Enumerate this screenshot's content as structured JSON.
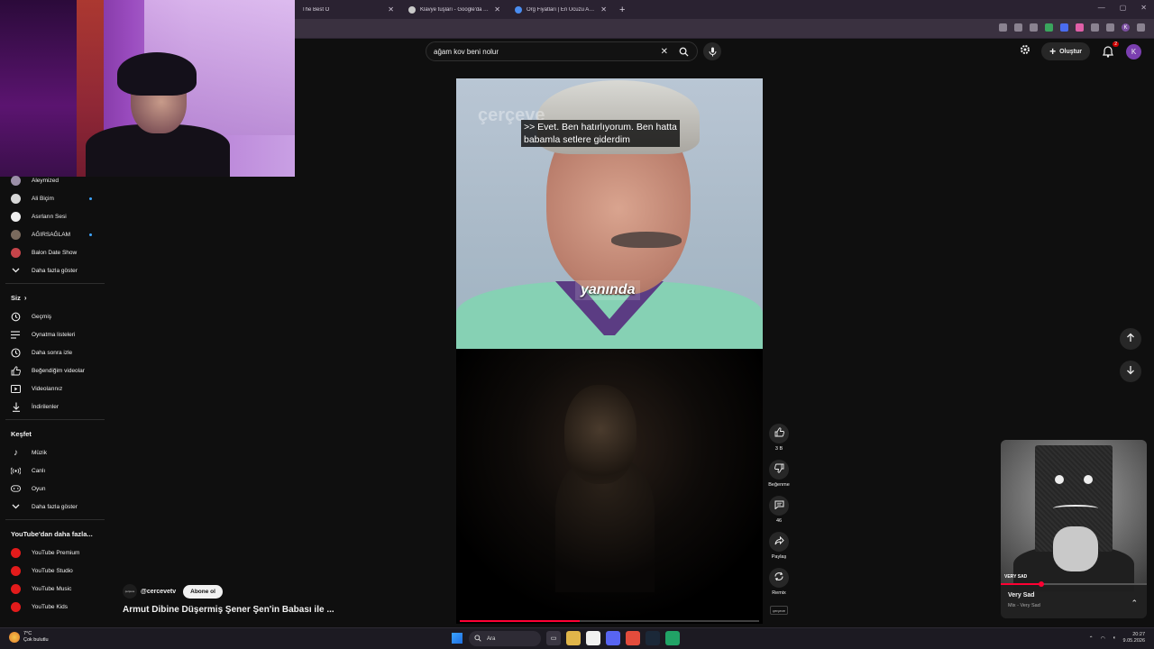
{
  "browser": {
    "tabs": [
      {
        "title": "The Best O"
      },
      {
        "title": "Klavye tuşları - Google'da Ara"
      },
      {
        "title": "Org Fiyatları | En Ucuzu Akakçe"
      }
    ],
    "new_tab_label": "+",
    "profile_initial": "K"
  },
  "search": {
    "query": "ağam kov beni nolur",
    "clear_label": "✕"
  },
  "header": {
    "create_label": "Oluştur",
    "notification_count": "2",
    "avatar_initial": "K"
  },
  "sidebar": {
    "subscriptions": [
      {
        "label": "Aleymized",
        "dot": false
      },
      {
        "label": "Ali Biçim",
        "dot": true
      },
      {
        "label": "Asırların Sesi",
        "dot": false
      },
      {
        "label": "AĞIRSAĞLAM",
        "dot": true
      },
      {
        "label": "Balon Date Show",
        "dot": false
      }
    ],
    "show_more_1": "Daha fazla göster",
    "you_heading": "Siz",
    "you_items": [
      {
        "label": "Geçmiş",
        "icon": "history-icon"
      },
      {
        "label": "Oynatma listeleri",
        "icon": "playlist-icon"
      },
      {
        "label": "Daha sonra izle",
        "icon": "clock-icon"
      },
      {
        "label": "Beğendiğim videolar",
        "icon": "thumbs-up-icon"
      },
      {
        "label": "Videolarınız",
        "icon": "video-icon"
      },
      {
        "label": "İndirilenler",
        "icon": "download-icon"
      }
    ],
    "explore_heading": "Keşfet",
    "explore_items": [
      {
        "label": "Müzik",
        "icon": "music-note-icon"
      },
      {
        "label": "Canlı",
        "icon": "live-icon"
      },
      {
        "label": "Oyun",
        "icon": "gamepad-icon"
      }
    ],
    "show_more_2": "Daha fazla göster",
    "more_heading": "YouTube'dan daha fazla...",
    "more_items": [
      {
        "label": "YouTube Premium"
      },
      {
        "label": "YouTube Studio"
      },
      {
        "label": "YouTube Music"
      },
      {
        "label": "YouTube Kids"
      }
    ]
  },
  "short": {
    "watermark": "çerçeve",
    "caption_line1": ">> Evet. Ben hatırlıyorum. Ben hatta",
    "caption_line2": "babamla setlere giderdim",
    "burned_subtitle": "yanında",
    "progress_fraction": 0.4,
    "channel_handle": "@cercevetv",
    "channel_avatar_text": "çerçeve",
    "subscribe_label": "Abone ol",
    "title": "Armut Dibine Düşermiş Şener Şen'in Babası ile ..."
  },
  "actions": {
    "like_count": "3 B",
    "dislike_label": "Beğenme",
    "comment_count": "46",
    "share_label": "Paylaş",
    "remix_label": "Remix",
    "audio_thumb_text": "çerçeve"
  },
  "miniplayer": {
    "cover_text": "VERY SAD",
    "title": "Very Sad",
    "subtitle": "Mix - Very Sad",
    "progress_fraction": 0.28
  },
  "taskbar": {
    "temperature": "7°C",
    "weather_text": "Çok bulutlu",
    "search_placeholder": "Ara",
    "time": "20:27",
    "date": "9.05.2026"
  },
  "colors": {
    "yt_red": "#ff0033",
    "background": "#0f0f0f",
    "chip": "#272727"
  }
}
